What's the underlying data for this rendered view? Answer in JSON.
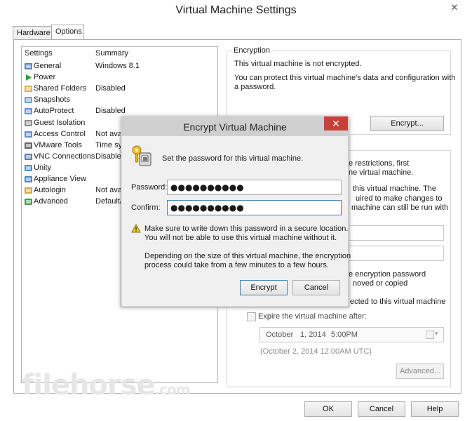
{
  "window": {
    "title": "Virtual Machine Settings",
    "close_glyph": "✕"
  },
  "tabs": [
    {
      "label": "Hardware",
      "active": false
    },
    {
      "label": "Options",
      "active": true
    }
  ],
  "settings_list": {
    "header_settings": "Settings",
    "header_summary": "Summary",
    "items": [
      {
        "label": "General",
        "summary": "Windows 8.1",
        "icon": "general-icon"
      },
      {
        "label": "Power",
        "summary": "",
        "icon": "power-icon"
      },
      {
        "label": "Shared Folders",
        "summary": "Disabled",
        "icon": "shared-folders-icon"
      },
      {
        "label": "Snapshots",
        "summary": "",
        "icon": "snapshots-icon"
      },
      {
        "label": "AutoProtect",
        "summary": "Disabled",
        "icon": "autoprotect-icon"
      },
      {
        "label": "Guest Isolation",
        "summary": "",
        "icon": "guest-isolation-icon"
      },
      {
        "label": "Access Control",
        "summary": "Not ava",
        "icon": "access-control-icon"
      },
      {
        "label": "VMware Tools",
        "summary": "Time sy",
        "icon": "vmware-tools-icon"
      },
      {
        "label": "VNC Connections",
        "summary": "Disable",
        "icon": "vnc-icon"
      },
      {
        "label": "Unity",
        "summary": "",
        "icon": "unity-icon"
      },
      {
        "label": "Appliance View",
        "summary": "",
        "icon": "appliance-view-icon"
      },
      {
        "label": "Autologin",
        "summary": "Not ava",
        "icon": "autologin-icon"
      },
      {
        "label": "Advanced",
        "summary": "Default/",
        "icon": "advanced-icon"
      }
    ]
  },
  "encryption": {
    "group_title": "Encryption",
    "status": "This virtual machine is not encrypted.",
    "desc_line1": "You can protect this virtual machine's data and configuration with",
    "desc_line2": "a password.",
    "encrypt_button": "Encrypt..."
  },
  "restrictions": {
    "line1": "e restrictions, first",
    "line2": "ne virtual machine.",
    "line3": "this virtual machine. The",
    "line4": "uired to make changes to",
    "line5": "machine can still be run with",
    "line6": "e encryption password",
    "line7": "noved or copied",
    "line8": "ected to this virtual machine",
    "expire_label": "Expire the virtual machine after:",
    "date_month": "October",
    "date_day_year": "1, 2014",
    "date_time": "5:00PM",
    "date_utc": "(October 2, 2014 12:00AM UTC)",
    "advanced_button": "Advanced..."
  },
  "footer": {
    "ok": "OK",
    "cancel": "Cancel",
    "help": "Help"
  },
  "dialog": {
    "title": "Encrypt Virtual Machine",
    "close_glyph": "✕",
    "instruction": "Set the password for this virtual machine.",
    "password_label": "Password:",
    "password_value": "●●●●●●●●●●",
    "confirm_label": "Confirm:",
    "confirm_value": "●●●●●●●●●●",
    "warning_line1": "Make sure to write down this password in a secure location.",
    "warning_line2": "You will not be able to use this virtual machine without it.",
    "info_line1": "Depending on the size of this virtual machine, the encryption",
    "info_line2": "process could take from a few minutes to a few hours.",
    "encrypt_button": "Encrypt",
    "cancel_button": "Cancel"
  },
  "watermark": {
    "text": "filehorse",
    "suffix": ".com"
  },
  "colors": {
    "accent": "#3c7fb1",
    "dialog_close": "#c7403a"
  }
}
